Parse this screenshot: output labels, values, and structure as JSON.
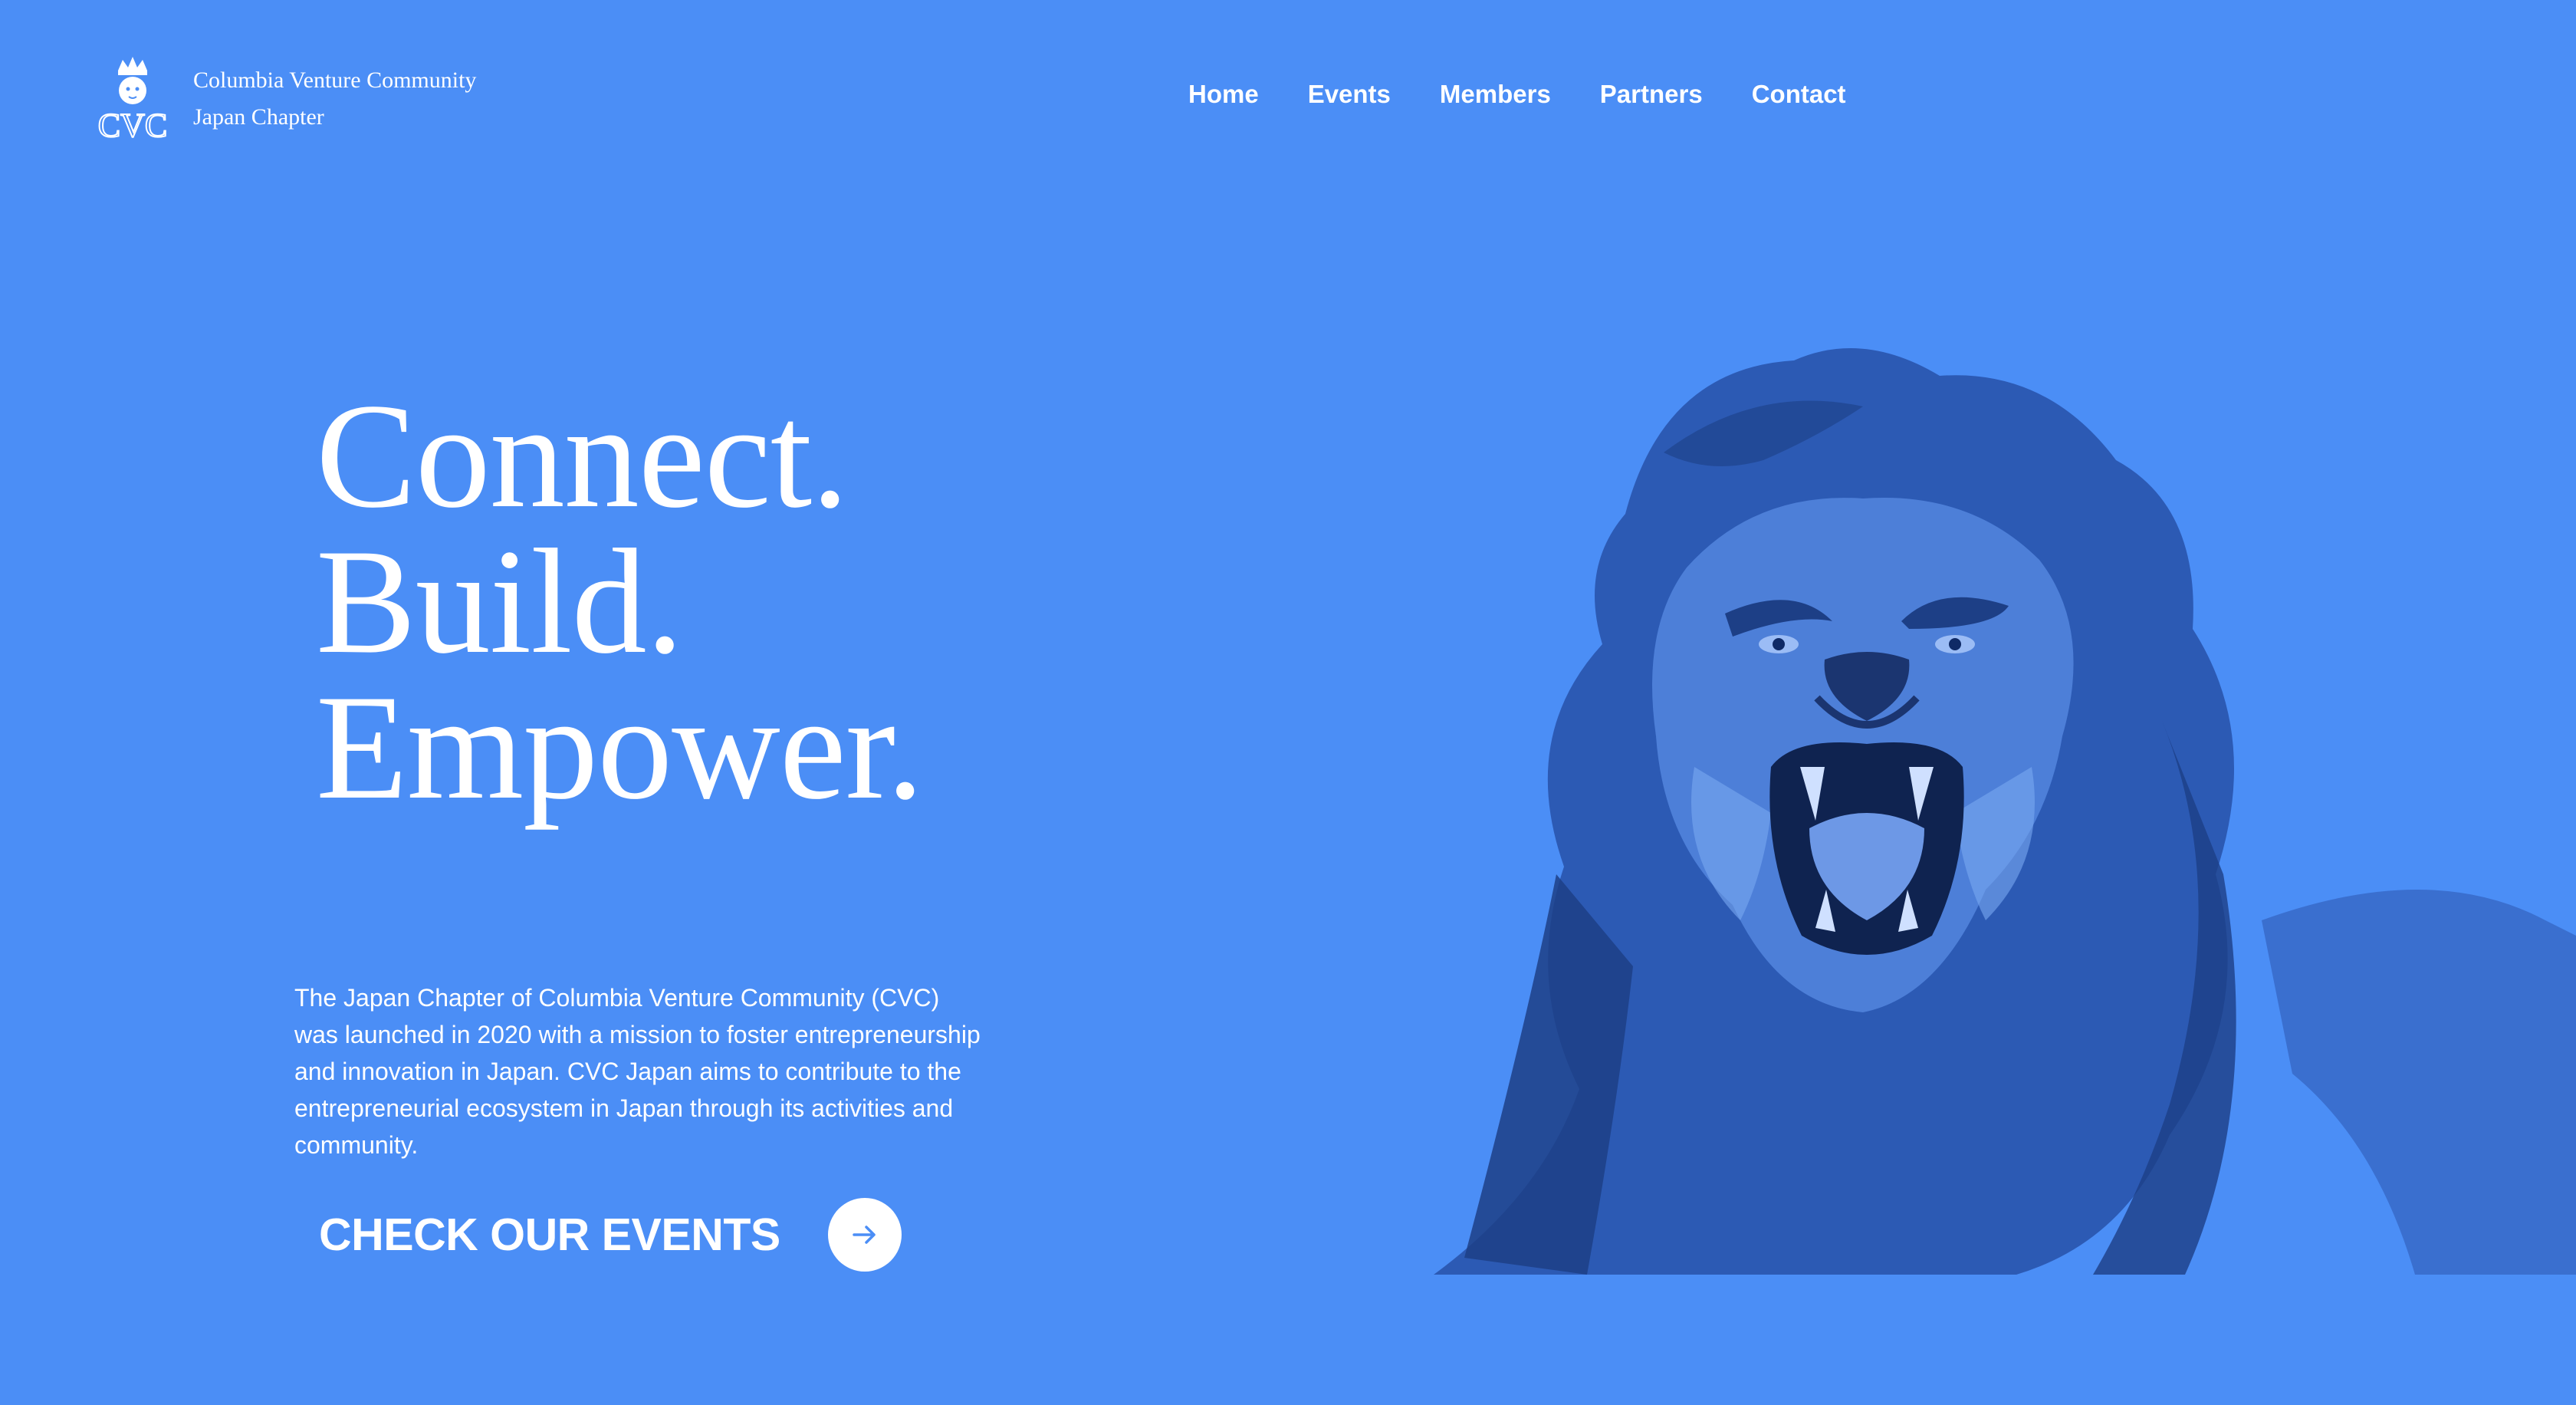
{
  "header": {
    "brand_line1": "Columbia Venture Community",
    "brand_line2": "Japan Chapter",
    "logo_icon": "crowned-lion-cvc-crest-icon"
  },
  "nav": {
    "items": [
      {
        "label": "Home"
      },
      {
        "label": "Events"
      },
      {
        "label": "Members"
      },
      {
        "label": "Partners"
      },
      {
        "label": "Contact"
      }
    ]
  },
  "hero": {
    "headline": [
      "Connect.",
      "Build.",
      "Empower."
    ],
    "intro": "The Japan Chapter of Columbia Venture Community (CVC) was launched in 2020 with a mission to foster entrepreneurship and innovation in Japan. CVC Japan aims to contribute to the entrepreneurial ecosystem in Japan through its activities and community.",
    "cta_label": "CHECK OUR EVENTS",
    "cta_icon": "arrow-right-icon",
    "image_icon": "roaring-lion-image"
  },
  "colors": {
    "background": "#4b8ef6",
    "text": "#ffffff",
    "lion_dark": "#1d3f86",
    "lion_mid": "#3a6fcf",
    "lion_light": "#7aa8f2"
  }
}
